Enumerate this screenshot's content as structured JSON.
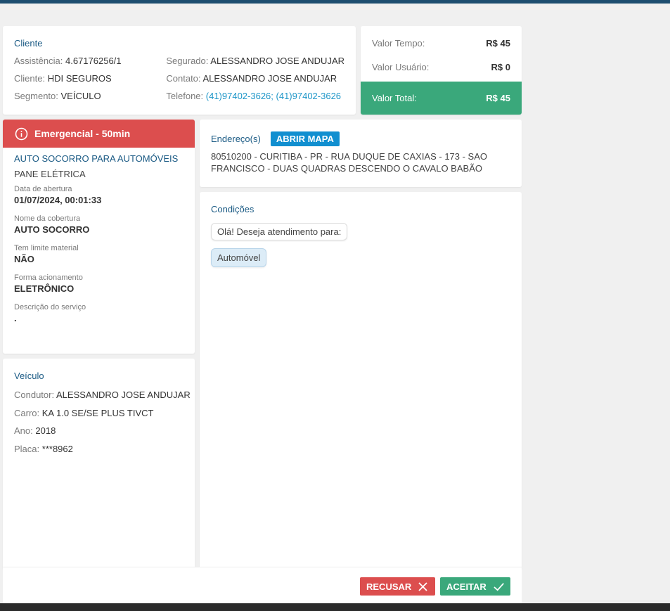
{
  "client": {
    "title": "Cliente",
    "assistencia_label": "Assistência:",
    "assistencia_value": "4.67176256/1",
    "cliente_label": "Cliente:",
    "cliente_value": "HDI SEGUROS",
    "segmento_label": "Segmento:",
    "segmento_value": "VEÍCULO",
    "segurado_label": "Segurado:",
    "segurado_value": "ALESSANDRO JOSE ANDUJAR",
    "contato_label": "Contato:",
    "contato_value": "ALESSANDRO JOSE ANDUJAR",
    "telefone_label": "Telefone:",
    "telefone_value": "(41)97402-3626; (41)97402-3626"
  },
  "values": {
    "tempo_label": "Valor Tempo:",
    "tempo_value": "R$ 45",
    "usuario_label": "Valor Usuário:",
    "usuario_value": "R$ 0",
    "total_label": "Valor Total:",
    "total_value": "R$ 45",
    "total_color": "#3aa87b"
  },
  "service": {
    "priority_label": "Emergencial - 50min",
    "priority_color": "#dc4e4e",
    "priority_icon": "info-circle-icon",
    "title": "AUTO SOCORRO PARA AUTOMÓVEIS",
    "subtitle": "PANE ELÉTRICA",
    "fields": [
      {
        "label": "Data de abertura",
        "value": "01/07/2024, 00:01:33"
      },
      {
        "label": "Nome da cobertura",
        "value": "AUTO SOCORRO"
      },
      {
        "label": "Tem limite material",
        "value": "NÃO"
      },
      {
        "label": "Forma acionamento",
        "value": "ELETRÔNICO"
      },
      {
        "label": "Descrição do serviço",
        "value": "."
      }
    ]
  },
  "vehicle": {
    "title": "Veículo",
    "condutor_label": "Condutor:",
    "condutor_value": "ALESSANDRO JOSE ANDUJAR",
    "carro_label": "Carro:",
    "carro_value": "KA 1.0 SE/SE PLUS TIVCT",
    "ano_label": "Ano:",
    "ano_value": "2018",
    "placa_label": "Placa:",
    "placa_value": "***8962"
  },
  "address": {
    "title": "Endereço(s)",
    "map_button": "ABRIR MAPA",
    "text": "80510200 - CURITIBA - PR - RUA DUQUE DE CAXIAS - 173 - SAO FRANCISCO - DUAS QUADRAS DESCENDO O CAVALO BABÃO"
  },
  "conditions": {
    "title": "Condições",
    "question": "Olá! Deseja atendimento para:",
    "answer": "Automóvel"
  },
  "footer": {
    "refuse_label": "RECUSAR",
    "refuse_icon": "close-icon",
    "accept_label": "ACEITAR",
    "accept_icon": "check-icon"
  }
}
